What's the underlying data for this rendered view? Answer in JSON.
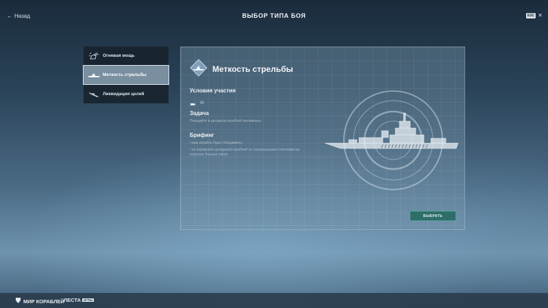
{
  "header": {
    "back_label": "Назад",
    "title": "ВЫБОР ТИПА БОЯ",
    "esc_key": "ESC",
    "close_icon": "close-icon"
  },
  "menu": {
    "items": [
      {
        "label": "Огневая мощь",
        "icon": "gun-turret-icon",
        "active": false
      },
      {
        "label": "Меткость стрельбы",
        "icon": "ship-icon",
        "active": true
      },
      {
        "label": "Ликвидация целей",
        "icon": "sinking-ship-icon",
        "active": false
      }
    ]
  },
  "panel": {
    "title": "Меткость стрельбы",
    "badge_icon": "ship-badge-icon",
    "conditions_heading": "Условия участия",
    "tier_icon": "ship-class-icon",
    "tier_value": "VI",
    "task_heading": "Задача",
    "task_text": "Попадайте в цитадели кораблей противника.",
    "briefing_heading": "Брифинг",
    "briefing_items": [
      "ваш корабль будет обездвижен;",
      "за поражения цитаделей кораблей со специальными отметками вы получите больше очков."
    ],
    "select_label": "ВЫБРАТЬ",
    "ship_illustration": "cruiser-silhouette"
  },
  "footer": {
    "logo_game": "МИР КОРАБЛЕЙ",
    "logo_company": "ЛЕСТА",
    "logo_company_sub": "ИГРЫ"
  },
  "colors": {
    "accent_button": "#2e6e6a",
    "active_menu_bg": "#96aab9",
    "menu_bg": "#16202a"
  }
}
